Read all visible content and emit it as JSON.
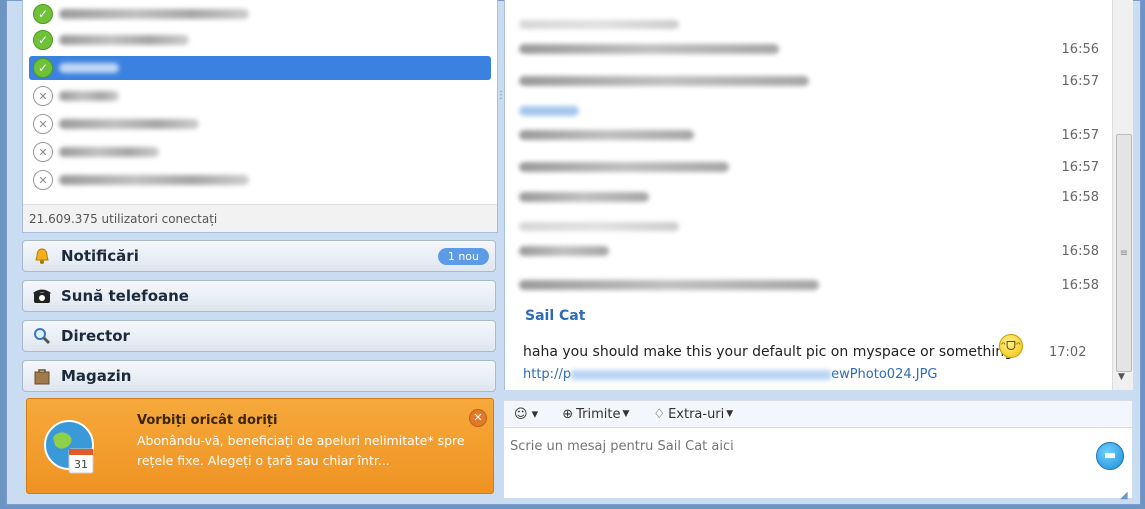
{
  "contacts": {
    "items": [
      {
        "status": "online",
        "status_icon": "check-icon"
      },
      {
        "status": "online",
        "status_icon": "check-icon"
      },
      {
        "status": "online",
        "status_icon": "check-icon",
        "selected": true
      },
      {
        "status": "offline",
        "status_icon": "x-icon"
      },
      {
        "status": "offline",
        "status_icon": "x-icon"
      },
      {
        "status": "offline",
        "status_icon": "x-icon"
      },
      {
        "status": "offline",
        "status_icon": "x-icon"
      }
    ],
    "users_online": "21.609.375 utilizatori conectați"
  },
  "sections": {
    "notifications": {
      "label": "Notificări",
      "badge": "1 nou",
      "icon": "bell-icon"
    },
    "call_phones": {
      "label": "Sună telefoane",
      "icon": "phone-icon"
    },
    "directory": {
      "label": "Director",
      "icon": "magnifier-icon"
    },
    "shop": {
      "label": "Magazin",
      "icon": "bag-icon"
    }
  },
  "promo": {
    "title": "Vorbiți oricât doriți",
    "text": "Abonându-vă, beneficiați de apeluri nelimitate* spre rețele fixe. Alegeți o țară sau chiar într...",
    "icon": "globe-calendar-icon",
    "calendar_number": "31"
  },
  "chat": {
    "times": [
      "16:56",
      "16:57",
      "16:57",
      "16:57",
      "16:58",
      "16:58",
      "16:58"
    ],
    "last_sender": "Sail Cat",
    "last_message": "haha you should make this your default pic on myspace or something",
    "last_time": "17:02",
    "link_prefix": "http://p",
    "link_suffix": "ewPhoto024.JPG"
  },
  "toolbar": {
    "emoticon_label": "☺ ▾",
    "send_label": "Trimite",
    "extras_label": "Extra-uri"
  },
  "input": {
    "placeholder": "Scrie un mesaj pentru Sail Cat aici"
  },
  "colors": {
    "accent": "#3b82e0",
    "sender": "#2f6cb6",
    "promo": "#f39a2a"
  }
}
